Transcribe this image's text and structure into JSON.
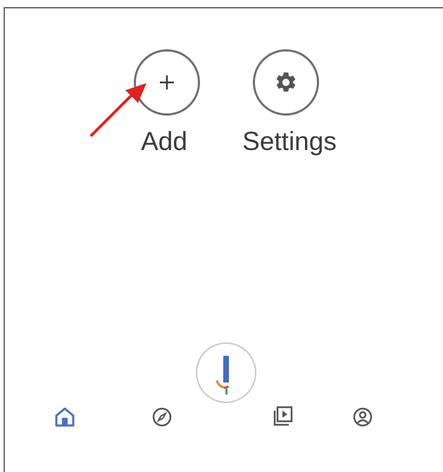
{
  "actions": {
    "add": {
      "label": "Add",
      "icon": "plus-icon"
    },
    "settings": {
      "label": "Settings",
      "icon": "gear-icon"
    }
  },
  "annotation": {
    "icon": "red-arrow-pointer",
    "color": "#e02020"
  },
  "bottom_nav": {
    "items": [
      {
        "icon": "home-icon",
        "active": true,
        "color": "#4a6fc2"
      },
      {
        "icon": "compass-icon",
        "active": false,
        "color": "#555555"
      },
      {
        "icon": "assistant-icon",
        "active": false
      },
      {
        "icon": "video-library-icon",
        "active": false,
        "color": "#555555"
      },
      {
        "icon": "account-icon",
        "active": false,
        "color": "#555555"
      }
    ]
  },
  "colors": {
    "accent": "#4a6fc2",
    "outline": "#6e6e6e",
    "assistant_blue": "#3f6fc4",
    "assistant_orange": "#e8832a",
    "assistant_red": "#d9412b",
    "assistant_green": "#34a853"
  }
}
